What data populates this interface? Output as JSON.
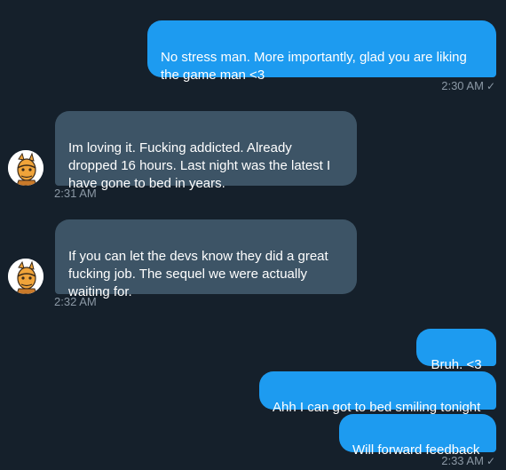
{
  "messages": [
    {
      "id": "m1",
      "direction": "sent",
      "text": "No stress man. More importantly, glad you are liking\nthe game man <3"
    },
    {
      "id": "m2",
      "direction": "received",
      "text": "Im loving it. Fucking addicted. Already\ndropped 16 hours. Last night was the latest I\nhave gone to bed in years."
    },
    {
      "id": "m3",
      "direction": "received",
      "text": "If you can let the devs know they did a great\nfucking job. The sequel we were actually\nwaiting for."
    },
    {
      "id": "m4",
      "direction": "sent",
      "text": "Bruh. <3"
    },
    {
      "id": "m5",
      "direction": "sent",
      "text": "Ahh I can got to bed smiling tonight"
    },
    {
      "id": "m6",
      "direction": "sent",
      "text": "Will forward feedback"
    }
  ],
  "timestamps": {
    "t1": "2:30 AM",
    "t2": "2:31 AM",
    "t3": "2:32 AM",
    "t4": "2:33 AM"
  },
  "read_receipt_icon": "checkmark-icon",
  "read_receipt_glyph": "✓",
  "avatar_icon": "cartoon-character-avatar",
  "colors": {
    "background": "#15202b",
    "sent_bubble": "#1d9bf0",
    "received_bubble": "#3d5466",
    "timestamp": "#8b98a5"
  }
}
